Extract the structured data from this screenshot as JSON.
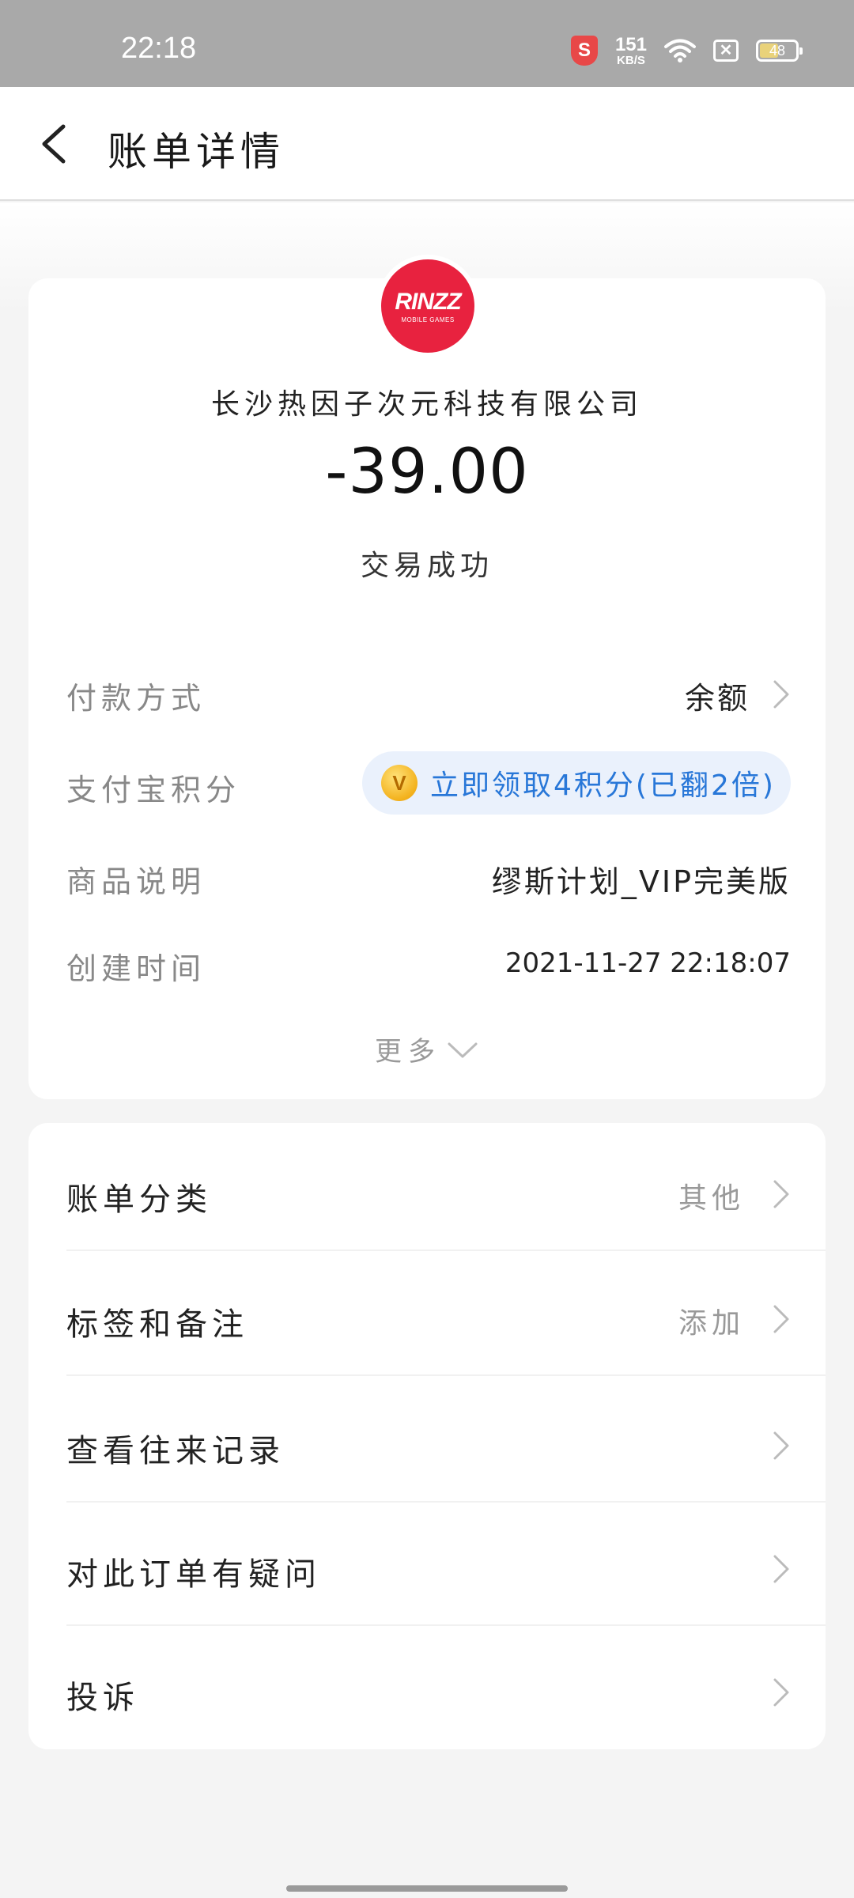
{
  "status_bar": {
    "time": "22:18",
    "network_speed_value": "151",
    "network_speed_unit": "KB/S",
    "battery": "48",
    "battery_level": 0.48,
    "security_badge": "S",
    "icons": [
      "shield-icon",
      "wifi-icon",
      "sim-disabled-icon",
      "battery-icon"
    ]
  },
  "header": {
    "title": "账单详情",
    "back_icon": "back-arrow-icon"
  },
  "merchant": {
    "logo_text": "RINZZ",
    "logo_subtext": "MOBILE GAMES",
    "logo_color": "#e8223f",
    "name": "长沙热因子次元科技有限公司"
  },
  "transaction": {
    "amount": "-39.00",
    "status": "交易成功"
  },
  "details": {
    "payment_method": {
      "label": "付款方式",
      "value": "余额"
    },
    "points": {
      "label": "支付宝积分",
      "value": "立即领取4积分(已翻2倍)",
      "coin_symbol": "V",
      "accent": "#2877d8"
    },
    "product": {
      "label": "商品说明",
      "value": "缪斯计划_VIP完美版"
    },
    "created": {
      "label": "创建时间",
      "value": "2021-11-27 22:18:07"
    },
    "more_label": "更多"
  },
  "actions": [
    {
      "label": "账单分类",
      "value": "其他"
    },
    {
      "label": "标签和备注",
      "value": "添加"
    },
    {
      "label": "查看往来记录",
      "value": ""
    },
    {
      "label": "对此订单有疑问",
      "value": ""
    },
    {
      "label": "投诉",
      "value": ""
    }
  ]
}
